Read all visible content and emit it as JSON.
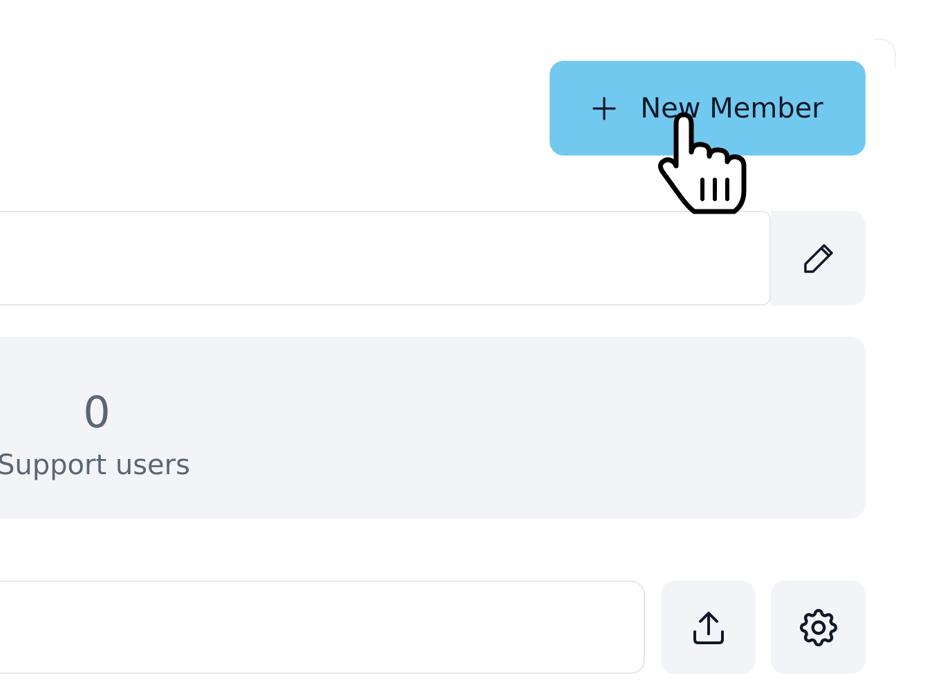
{
  "header": {
    "new_member_label": "New Member",
    "new_member_icon": "plus-icon",
    "accent_color": "#72C9EF"
  },
  "name_field": {
    "value": "",
    "edit_icon": "pencil-icon"
  },
  "stats": {
    "support_users_value": "0",
    "support_users_label": "Support users"
  },
  "toolbar": {
    "search_value": "",
    "export_icon": "upload-icon",
    "settings_icon": "gear-icon"
  },
  "cursor": {
    "icon": "hand-pointer-icon"
  }
}
